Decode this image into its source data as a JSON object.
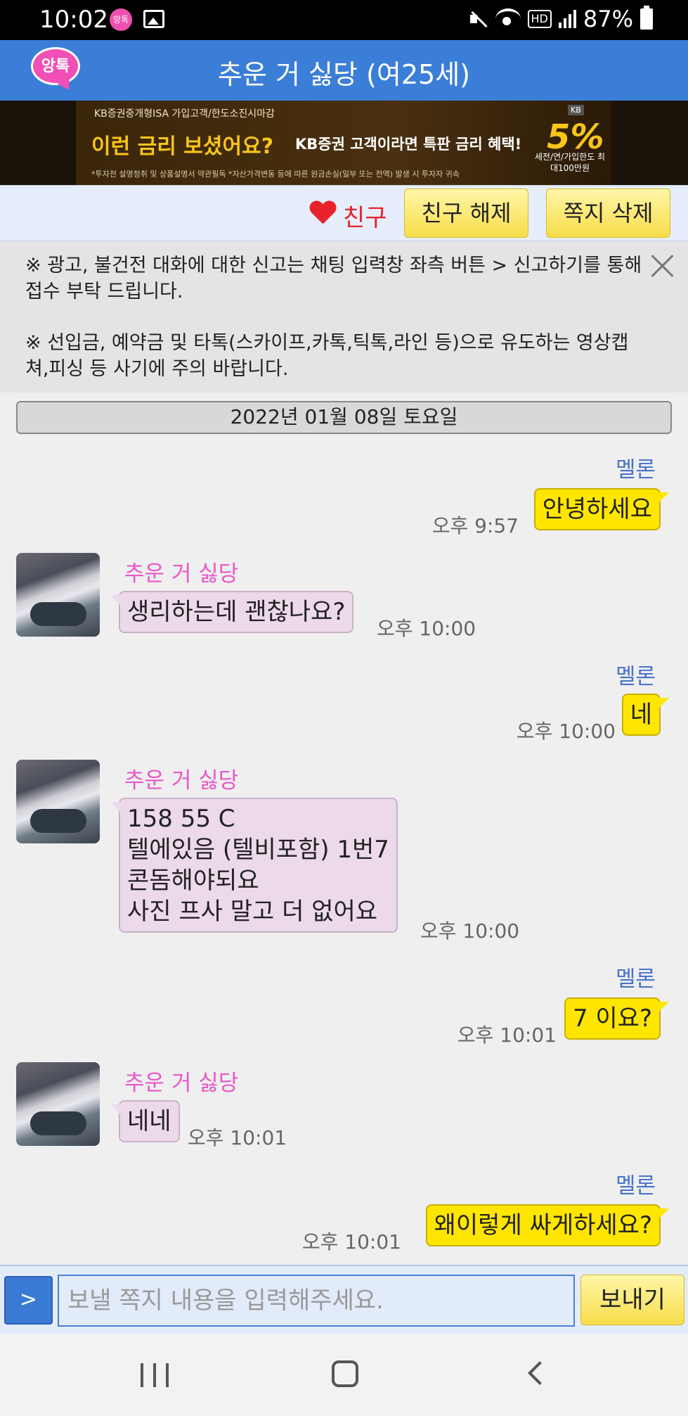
{
  "status_bar": {
    "time": "10:02",
    "battery": "87%",
    "app_icon_text": "앙톡",
    "hd_label": "HD"
  },
  "header": {
    "logo_text": "앙톡",
    "title": "추운 거 싫당 (여25세)"
  },
  "ad": {
    "top_text": "KB증권중개형ISA 가입고객/한도소진시마감",
    "headline": "이런 금리 보셨어요?",
    "subline": "KB증권 고객이라면 특판 금리 혜택!",
    "footnote": "*투자전 설명청취 및 상품설명서 약관필독 *자산가격변동 등에 따른 원금손실(일부 또는 전액) 발생 시 투자자 귀속",
    "rate": "5%",
    "rate_caption": "세전/연/가입한도 최대100만원",
    "brand": "KB"
  },
  "actions": {
    "friend_label": "친구",
    "unfriend_button": "친구 해제",
    "delete_button": "쪽지 삭제"
  },
  "notice": {
    "line1": "※ 광고, 불건전 대화에 대한 신고는 채팅 입력창 좌측 버튼 > 신고하기를 통해 접수 부탁 드립니다.",
    "line2": "※ 선입금, 예약금 및 타톡(스카이프,카톡,틱톡,라인 등)으로 유도하는 영상캡쳐,피싱 등 사기에 주의 바랍니다."
  },
  "chat": {
    "date": "2022년 01월 08일 토요일",
    "me_name": "멜론",
    "other_name": "추운 거 싫당",
    "messages": [
      {
        "from": "me",
        "text": "안녕하세요",
        "time": "오후 9:57"
      },
      {
        "from": "other",
        "text": "생리하는데 괜찮나요?",
        "time": "오후 10:00"
      },
      {
        "from": "me",
        "text": "네",
        "time": "오후 10:00"
      },
      {
        "from": "other",
        "lines": [
          "158 55 C",
          "텔에있음 (텔비포함) 1번7",
          "콘돔해야되요",
          "사진 프사 말고 더 없어요"
        ],
        "time": "오후 10:00"
      },
      {
        "from": "me",
        "text": "7 이요?",
        "time": "오후 10:01"
      },
      {
        "from": "other",
        "text": "네네",
        "time": "오후 10:01"
      },
      {
        "from": "me",
        "text": "왜이렇게 싸게하세요?",
        "time": "오후 10:01"
      }
    ]
  },
  "input": {
    "menu_label": ">",
    "placeholder": "보낼 쪽지 내용을 입력해주세요.",
    "send_label": "보내기"
  },
  "colors": {
    "header": "#3b7ed8",
    "my_bubble": "#ffe600",
    "other_bubble": "#ecd9ea",
    "my_name": "#4a74c9",
    "other_name": "#e858c8",
    "friend_heart": "#e8222b"
  }
}
